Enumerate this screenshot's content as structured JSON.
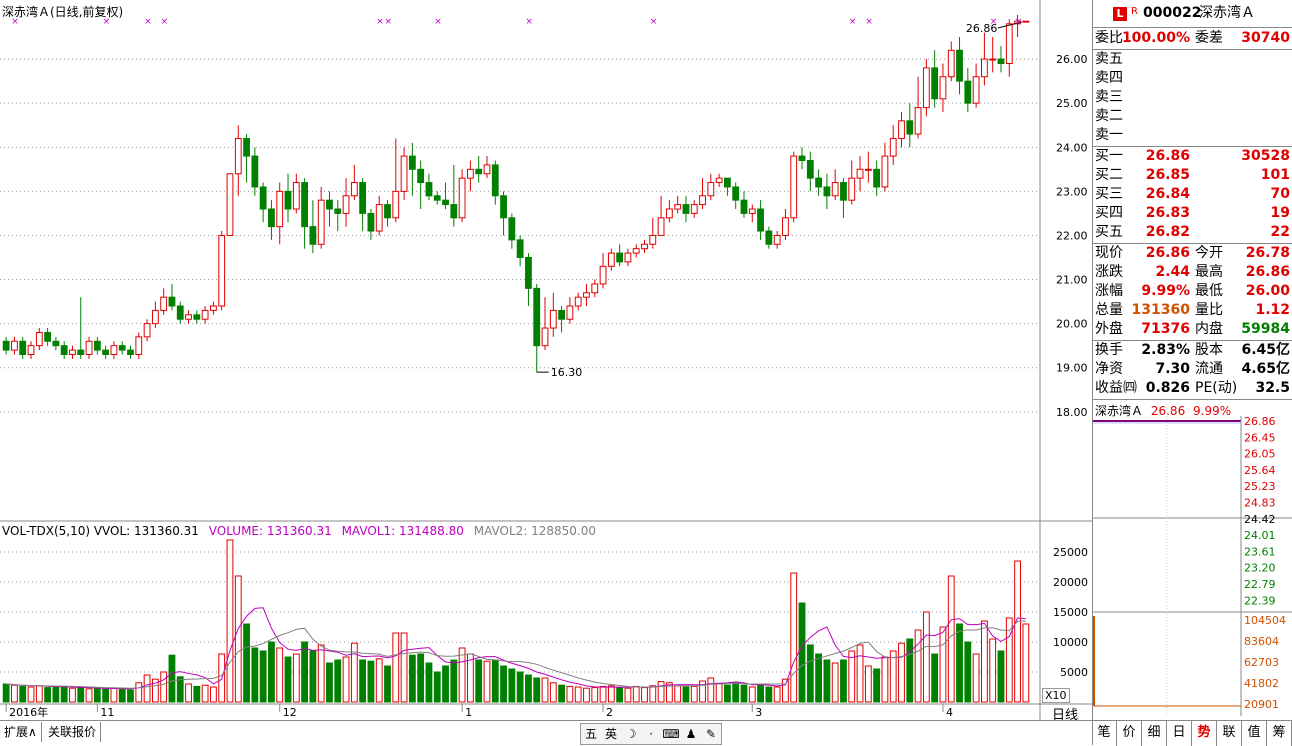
{
  "stock": {
    "code": "000022",
    "name": "深赤湾Ａ",
    "badge_l": "L",
    "badge_r": "R"
  },
  "chart_title": "深赤湾Ａ(日线,前复权)",
  "price_max_label": "26.86",
  "price_min_label": "16.30",
  "volume_legend": {
    "vol": "VOL-TDX(5,10)  VVOL: 131360.31",
    "volume": "VOLUME: 131360.31",
    "mavol1": "MAVOL1: 131488.80",
    "mavol2": "MAVOL2: 128850.00"
  },
  "vol_scale_label": "X10",
  "period_label": "日线",
  "x_axis_labels": [
    {
      "text": "2016年",
      "idx": 0
    },
    {
      "text": "11",
      "idx": 11
    },
    {
      "text": "12",
      "idx": 33
    },
    {
      "text": "1",
      "idx": 55
    },
    {
      "text": "2",
      "idx": 72
    },
    {
      "text": "3",
      "idx": 90
    },
    {
      "text": "4",
      "idx": 113
    }
  ],
  "price_axis": [
    "26.00",
    "25.00",
    "24.00",
    "23.00",
    "22.00",
    "21.00",
    "20.00",
    "19.00",
    "18.00"
  ],
  "volume_axis": [
    "25000",
    "20000",
    "15000",
    "10000",
    "5000"
  ],
  "orderbook": {
    "weibi_label": "委比",
    "weibi": "100.00%",
    "weicha_label": "委差",
    "weicha": "30740",
    "sells": [
      {
        "label": "卖五"
      },
      {
        "label": "卖四"
      },
      {
        "label": "卖三"
      },
      {
        "label": "卖二"
      },
      {
        "label": "卖一"
      }
    ],
    "buys": [
      {
        "label": "买一",
        "price": "26.86",
        "vol": "30528"
      },
      {
        "label": "买二",
        "price": "26.85",
        "vol": "101"
      },
      {
        "label": "买三",
        "price": "26.84",
        "vol": "70"
      },
      {
        "label": "买四",
        "price": "26.83",
        "vol": "19"
      },
      {
        "label": "买五",
        "price": "26.82",
        "vol": "22"
      }
    ]
  },
  "quote": [
    {
      "l1": "现价",
      "v1": "26.86",
      "l2": "今开",
      "v2": "26.78"
    },
    {
      "l1": "涨跌",
      "v1": "2.44",
      "l2": "最高",
      "v2": "26.86"
    },
    {
      "l1": "涨幅",
      "v1": "9.99%",
      "l2": "最低",
      "v2": "26.00"
    },
    {
      "l1": "总量",
      "v1": "131360",
      "l2": "量比",
      "v2": "1.12"
    },
    {
      "l1": "外盘",
      "v1": "71376",
      "l2": "内盘",
      "v2": "59984"
    }
  ],
  "fundamentals": [
    {
      "l1": "换手",
      "v1": "2.83%",
      "l2": "股本",
      "v2": "6.45亿"
    },
    {
      "l1": "净资",
      "v1": "7.30",
      "l2": "流通",
      "v2": "4.65亿"
    },
    {
      "l1": "收益㈣",
      "v1": "0.826",
      "l2": "PE(动)",
      "v2": "32.5"
    }
  ],
  "mini_header": {
    "name": "深赤湾Ａ",
    "price": "26.86",
    "pct": "9.99%"
  },
  "mini_price_axis": [
    "26.86",
    "26.45",
    "26.05",
    "25.64",
    "25.23",
    "24.83",
    "24.42",
    "24.01",
    "23.61",
    "23.20",
    "22.79",
    "22.39"
  ],
  "mini_vol_axis": [
    "104504",
    "83604",
    "62703",
    "41802",
    "20901"
  ],
  "bottom_tabs": [
    "扩展∧",
    "关联报价"
  ],
  "toolbar_icons": [
    "五",
    "英",
    "☽",
    "·",
    "⌨",
    "♟",
    "✎"
  ],
  "right_tabs": [
    "笔",
    "价",
    "细",
    "日",
    "势",
    "联",
    "值",
    "筹"
  ],
  "colors": {
    "up": "#e00000",
    "down": "#008000",
    "ma1": "#c000c0",
    "ma2": "#808080"
  },
  "chart_data": {
    "type": "candlestick",
    "price_ylim": [
      16.3,
      26.86
    ],
    "volume_ylim": [
      0,
      27000
    ],
    "candles": [
      [
        19.6,
        19.4,
        19.7,
        19.3,
        3000
      ],
      [
        19.4,
        19.6,
        19.7,
        19.3,
        2800
      ],
      [
        19.6,
        19.3,
        19.7,
        19.2,
        2600
      ],
      [
        19.3,
        19.5,
        19.6,
        19.2,
        2500
      ],
      [
        19.5,
        19.8,
        19.9,
        19.4,
        2700
      ],
      [
        19.8,
        19.6,
        19.9,
        19.5,
        2400
      ],
      [
        19.6,
        19.5,
        19.7,
        19.4,
        2600
      ],
      [
        19.5,
        19.3,
        19.6,
        19.2,
        2500
      ],
      [
        19.3,
        19.4,
        19.5,
        19.2,
        2300
      ],
      [
        19.4,
        19.3,
        20.6,
        19.2,
        2400
      ],
      [
        19.3,
        19.6,
        19.7,
        19.2,
        2200
      ],
      [
        19.6,
        19.4,
        19.7,
        19.3,
        2300
      ],
      [
        19.4,
        19.3,
        19.5,
        19.2,
        2100
      ],
      [
        19.3,
        19.5,
        19.6,
        19.2,
        2300
      ],
      [
        19.5,
        19.4,
        19.6,
        19.3,
        2200
      ],
      [
        19.4,
        19.3,
        19.5,
        19.2,
        2000
      ],
      [
        19.3,
        19.7,
        19.8,
        19.2,
        3200
      ],
      [
        19.7,
        20.0,
        20.1,
        19.6,
        4500
      ],
      [
        20.0,
        20.3,
        20.5,
        19.9,
        3800
      ],
      [
        20.3,
        20.6,
        20.8,
        20.2,
        5000
      ],
      [
        20.6,
        20.4,
        20.9,
        20.3,
        7800
      ],
      [
        20.4,
        20.1,
        20.5,
        20.0,
        4200
      ],
      [
        20.1,
        20.2,
        20.3,
        20.0,
        3000
      ],
      [
        20.2,
        20.1,
        20.3,
        20.0,
        2600
      ],
      [
        20.1,
        20.3,
        20.4,
        20.0,
        2800
      ],
      [
        20.3,
        20.4,
        20.5,
        20.2,
        2500
      ],
      [
        20.4,
        22.0,
        22.1,
        20.3,
        8000
      ],
      [
        22.0,
        23.4,
        23.4,
        22.0,
        27000
      ],
      [
        23.4,
        24.2,
        24.5,
        22.9,
        21000
      ],
      [
        24.2,
        23.8,
        24.3,
        23.2,
        13000
      ],
      [
        23.8,
        23.1,
        24.0,
        22.9,
        9000
      ],
      [
        23.1,
        22.6,
        23.2,
        22.3,
        8500
      ],
      [
        22.6,
        22.2,
        22.8,
        21.9,
        10000
      ],
      [
        22.2,
        23.0,
        23.2,
        21.8,
        9000
      ],
      [
        23.0,
        22.6,
        23.4,
        22.3,
        7500
      ],
      [
        22.6,
        23.2,
        23.4,
        22.5,
        8000
      ],
      [
        23.2,
        22.2,
        23.3,
        21.7,
        10000
      ],
      [
        22.2,
        21.8,
        22.8,
        21.6,
        8500
      ],
      [
        21.8,
        22.8,
        23.1,
        21.7,
        9500
      ],
      [
        22.8,
        22.6,
        23.0,
        22.2,
        6500
      ],
      [
        22.6,
        22.5,
        22.8,
        22.1,
        7000
      ],
      [
        22.5,
        22.9,
        23.3,
        22.2,
        7500
      ],
      [
        22.9,
        23.2,
        23.6,
        22.8,
        9800
      ],
      [
        23.2,
        22.5,
        23.3,
        22.1,
        7000
      ],
      [
        22.5,
        22.1,
        22.6,
        21.9,
        6800
      ],
      [
        22.1,
        22.7,
        22.9,
        22.0,
        7200
      ],
      [
        22.7,
        22.4,
        22.8,
        22.2,
        6000
      ],
      [
        22.4,
        23.0,
        24.2,
        22.3,
        11500
      ],
      [
        23.0,
        23.8,
        24.0,
        22.8,
        11500
      ],
      [
        23.8,
        23.5,
        24.1,
        22.9,
        7800
      ],
      [
        23.5,
        23.2,
        23.7,
        22.6,
        8000
      ],
      [
        23.2,
        22.9,
        23.4,
        22.8,
        6500
      ],
      [
        22.9,
        22.8,
        23.0,
        22.7,
        5000
      ],
      [
        22.8,
        22.7,
        23.2,
        22.6,
        6000
      ],
      [
        22.7,
        22.4,
        23.6,
        22.2,
        7000
      ],
      [
        22.4,
        23.3,
        23.5,
        22.3,
        9000
      ],
      [
        23.3,
        23.5,
        23.7,
        23.0,
        8000
      ],
      [
        23.5,
        23.4,
        23.8,
        23.2,
        7000
      ],
      [
        23.4,
        23.6,
        23.8,
        23.3,
        6800
      ],
      [
        23.6,
        22.9,
        23.7,
        22.7,
        7000
      ],
      [
        22.9,
        22.4,
        23.0,
        22.0,
        6000
      ],
      [
        22.4,
        21.9,
        22.5,
        21.7,
        5500
      ],
      [
        21.9,
        21.5,
        22.0,
        21.3,
        5000
      ],
      [
        21.5,
        20.8,
        21.6,
        20.4,
        4500
      ],
      [
        20.8,
        19.5,
        20.9,
        18.9,
        4000
      ],
      [
        19.5,
        19.9,
        20.6,
        19.4,
        4000
      ],
      [
        19.9,
        20.3,
        20.7,
        19.7,
        3200
      ],
      [
        20.3,
        20.1,
        20.4,
        19.8,
        2800
      ],
      [
        20.1,
        20.4,
        20.6,
        20.0,
        2600
      ],
      [
        20.4,
        20.6,
        20.7,
        20.3,
        2500
      ],
      [
        20.6,
        20.7,
        20.9,
        20.4,
        2300
      ],
      [
        20.7,
        20.9,
        21.0,
        20.6,
        2400
      ],
      [
        20.9,
        21.3,
        21.6,
        20.8,
        2600
      ],
      [
        21.3,
        21.6,
        21.7,
        21.2,
        2700
      ],
      [
        21.6,
        21.4,
        21.8,
        21.3,
        2400
      ],
      [
        21.4,
        21.6,
        21.7,
        21.3,
        2300
      ],
      [
        21.6,
        21.7,
        21.8,
        21.5,
        2600
      ],
      [
        21.7,
        21.8,
        21.9,
        21.6,
        2400
      ],
      [
        21.8,
        22.0,
        22.4,
        21.7,
        2700
      ],
      [
        22.0,
        22.4,
        22.9,
        22.0,
        3400
      ],
      [
        22.4,
        22.6,
        22.8,
        22.3,
        3200
      ],
      [
        22.6,
        22.7,
        22.9,
        22.5,
        2700
      ],
      [
        22.7,
        22.5,
        22.9,
        22.3,
        2500
      ],
      [
        22.5,
        22.7,
        22.8,
        22.4,
        2600
      ],
      [
        22.7,
        22.9,
        23.3,
        22.6,
        3500
      ],
      [
        22.9,
        23.2,
        23.4,
        22.8,
        4000
      ],
      [
        23.2,
        23.3,
        23.4,
        23.1,
        3000
      ],
      [
        23.3,
        23.1,
        23.3,
        22.9,
        2800
      ],
      [
        23.1,
        22.8,
        23.2,
        22.6,
        3300
      ],
      [
        22.8,
        22.5,
        23.0,
        22.4,
        2800
      ],
      [
        22.5,
        22.6,
        22.7,
        22.3,
        2500
      ],
      [
        22.6,
        22.1,
        22.8,
        21.9,
        3000
      ],
      [
        22.1,
        21.8,
        22.2,
        21.7,
        2500
      ],
      [
        21.8,
        22.0,
        22.1,
        21.7,
        2500
      ],
      [
        22.0,
        22.4,
        22.6,
        21.9,
        3800
      ],
      [
        22.4,
        23.8,
        23.9,
        22.3,
        21500
      ],
      [
        23.8,
        23.7,
        24.0,
        23.5,
        16500
      ],
      [
        23.7,
        23.3,
        23.9,
        23.0,
        9500
      ],
      [
        23.3,
        23.1,
        23.5,
        22.9,
        8000
      ],
      [
        23.1,
        22.9,
        23.4,
        22.6,
        7000
      ],
      [
        22.9,
        23.2,
        23.5,
        22.8,
        6500
      ],
      [
        23.2,
        22.8,
        23.3,
        22.4,
        7000
      ],
      [
        22.8,
        23.3,
        23.7,
        22.7,
        8500
      ],
      [
        23.3,
        23.5,
        23.8,
        23.0,
        9500
      ],
      [
        23.5,
        23.5,
        23.9,
        23.2,
        6000
      ],
      [
        23.5,
        23.1,
        23.7,
        22.9,
        5500
      ],
      [
        23.1,
        23.8,
        24.1,
        23.0,
        7500
      ],
      [
        23.8,
        24.2,
        24.5,
        23.6,
        8500
      ],
      [
        24.2,
        24.6,
        24.8,
        24.0,
        9800
      ],
      [
        24.6,
        24.3,
        25.0,
        24.0,
        10500
      ],
      [
        24.3,
        24.9,
        25.6,
        24.2,
        12000
      ],
      [
        24.9,
        25.8,
        26.0,
        24.7,
        15000
      ],
      [
        25.8,
        25.1,
        26.2,
        24.9,
        8000
      ],
      [
        25.1,
        25.6,
        25.9,
        24.8,
        12500
      ],
      [
        25.6,
        26.2,
        26.4,
        25.5,
        21000
      ],
      [
        26.2,
        25.5,
        26.5,
        25.2,
        13000
      ],
      [
        25.5,
        25.0,
        25.8,
        24.8,
        10000
      ],
      [
        25.0,
        25.6,
        25.9,
        24.9,
        8000
      ],
      [
        25.6,
        26.0,
        26.6,
        25.4,
        13500
      ],
      [
        26.0,
        26.0,
        26.5,
        25.7,
        10500
      ],
      [
        26.0,
        25.9,
        26.3,
        25.7,
        8500
      ],
      [
        25.9,
        26.8,
        26.9,
        25.6,
        14000
      ],
      [
        26.8,
        26.86,
        27.0,
        26.5,
        23500
      ],
      [
        26.86,
        26.86,
        26.86,
        26.86,
        13000
      ]
    ]
  }
}
